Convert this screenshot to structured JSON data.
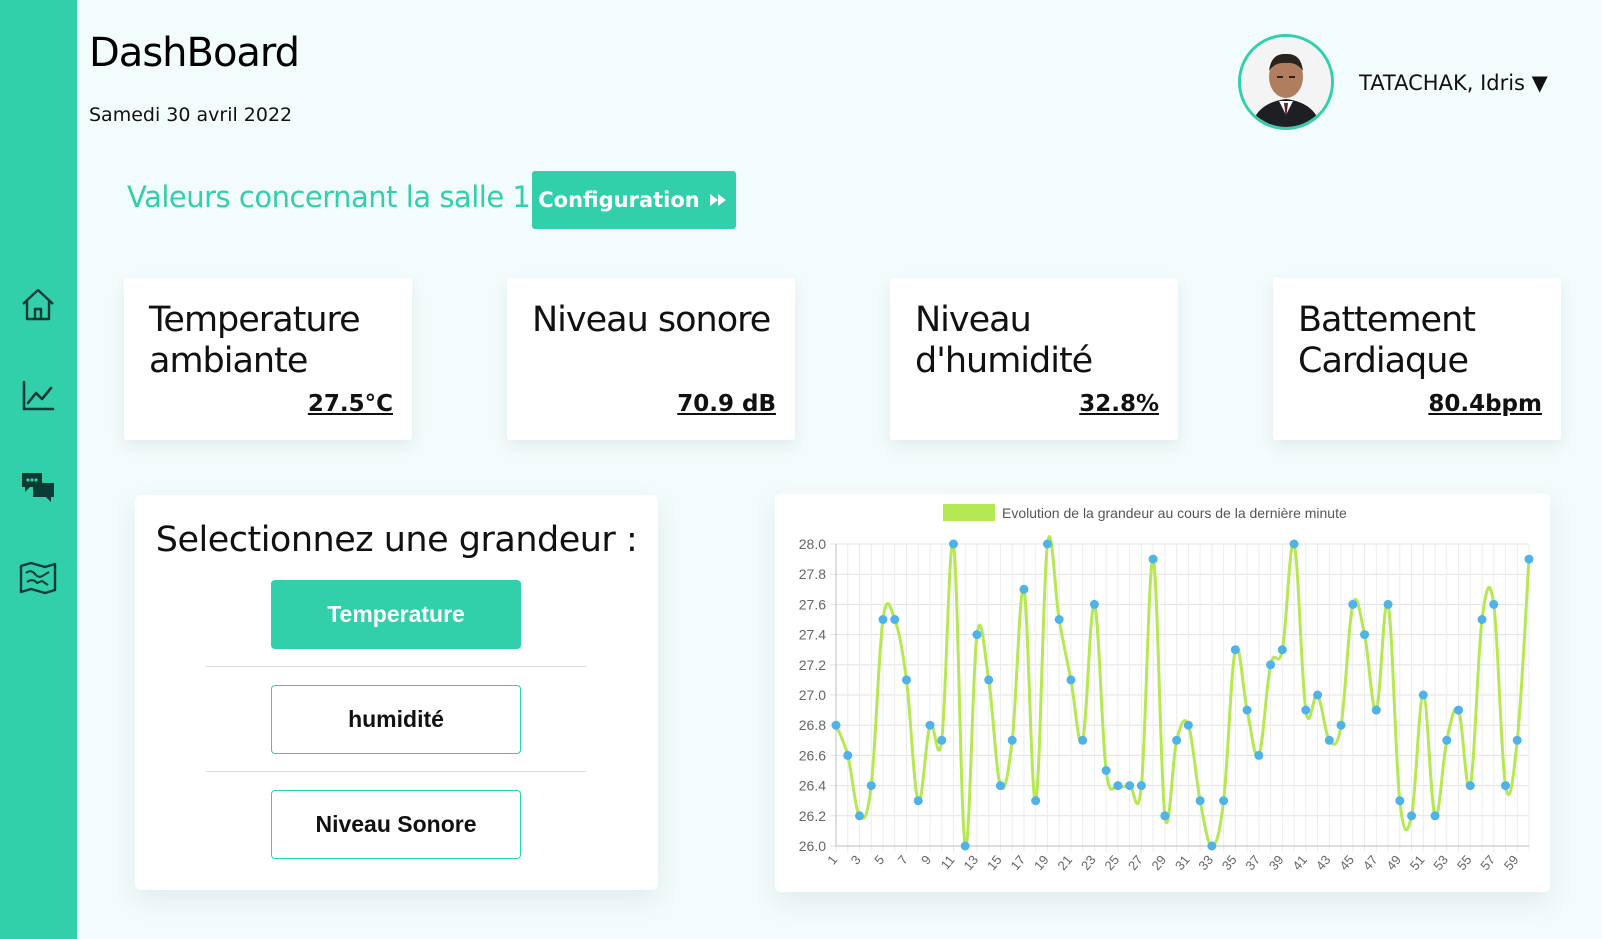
{
  "header": {
    "title": "DashBoard",
    "date": "Samedi 30 avril 2022",
    "user_name": "TATACHAK, Idris ▼"
  },
  "sidebar": {
    "items": [
      {
        "icon": "home-icon"
      },
      {
        "icon": "line-chart-icon"
      },
      {
        "icon": "chat-icon"
      },
      {
        "icon": "map-icon"
      }
    ]
  },
  "section": {
    "title": "Valeurs concernant la salle 11 :",
    "config_label": "Configuration"
  },
  "cards": [
    {
      "label": "Temperature ambiante",
      "value": "27.5°C"
    },
    {
      "label": "Niveau sonore",
      "value": "70.9 dB"
    },
    {
      "label": "Niveau d'humidité",
      "value": "32.8%"
    },
    {
      "label": "Battement Cardiaque",
      "value": "80.4bpm"
    }
  ],
  "selector": {
    "title": "Selectionnez une grandeur :",
    "options": [
      "Temperature",
      "humidité",
      "Niveau Sonore"
    ],
    "active": "Temperature"
  },
  "colors": {
    "accent": "#31d0aa",
    "line": "#b5e853",
    "point": "#4fb3e8"
  },
  "chart_data": {
    "type": "line",
    "legend": "Evolution de la grandeur au cours de la dernière minute",
    "ylim": [
      26.0,
      28.0
    ],
    "yticks": [
      26.0,
      26.2,
      26.4,
      26.6,
      26.8,
      27.0,
      27.2,
      27.4,
      27.6,
      27.8,
      28.0
    ],
    "x": [
      1,
      2,
      3,
      4,
      5,
      6,
      7,
      8,
      9,
      10,
      11,
      12,
      13,
      14,
      15,
      16,
      17,
      18,
      19,
      20,
      21,
      22,
      23,
      24,
      25,
      26,
      27,
      28,
      29,
      30,
      31,
      32,
      33,
      34,
      35,
      36,
      37,
      38,
      39,
      40,
      41,
      42,
      43,
      44,
      45,
      46,
      47,
      48,
      49,
      50,
      51,
      52,
      53,
      54,
      55,
      56,
      57,
      58,
      59,
      60
    ],
    "xtick_labels": [
      "1",
      "3",
      "5",
      "7",
      "9",
      "11",
      "13",
      "15",
      "17",
      "19",
      "21",
      "23",
      "25",
      "27",
      "29",
      "31",
      "33",
      "35",
      "37",
      "39",
      "41",
      "43",
      "45",
      "47",
      "49",
      "51",
      "53",
      "55",
      "57",
      "59"
    ],
    "values": [
      26.8,
      26.6,
      26.2,
      26.4,
      27.5,
      27.5,
      27.1,
      26.3,
      26.8,
      26.7,
      28.0,
      26.0,
      27.4,
      27.1,
      26.4,
      26.7,
      27.7,
      26.3,
      28.0,
      27.5,
      27.1,
      26.7,
      27.6,
      26.5,
      26.4,
      26.4,
      26.4,
      27.9,
      26.2,
      26.7,
      26.8,
      26.3,
      26.0,
      26.3,
      27.3,
      26.9,
      26.6,
      27.2,
      27.3,
      28.0,
      26.9,
      27.0,
      26.7,
      26.8,
      27.6,
      27.4,
      26.9,
      27.6,
      26.3,
      26.2,
      27.0,
      26.2,
      26.7,
      26.9,
      26.4,
      27.5,
      27.6,
      26.4,
      26.7,
      27.9
    ],
    "grid": true,
    "legend_position": "top-center"
  }
}
